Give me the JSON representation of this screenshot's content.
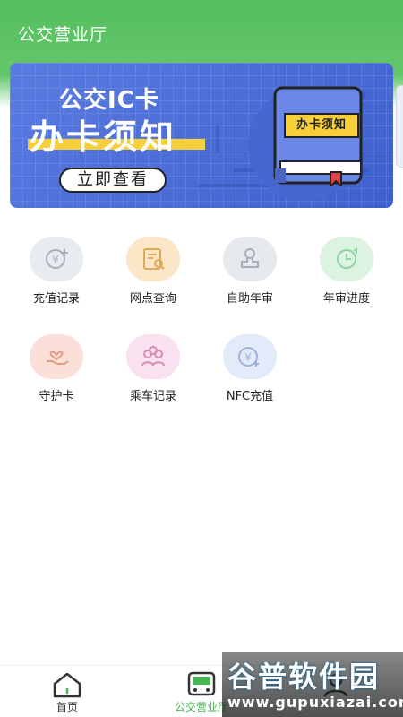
{
  "header": {
    "title": "公交营业厅"
  },
  "banner": {
    "line1": "公交IC卡",
    "line2": "办卡须知",
    "button": "立即查看",
    "book_label": "办卡须知"
  },
  "grid": {
    "items": [
      {
        "label": "充值记录",
        "icon": "yuan-add-icon",
        "color": "#e8ecf1"
      },
      {
        "label": "网点查询",
        "icon": "search-doc-icon",
        "color": "#fbe7c7"
      },
      {
        "label": "自助年审",
        "icon": "stamp-icon",
        "color": "#e6e9ee"
      },
      {
        "label": "年审进度",
        "icon": "clock-icon",
        "color": "#dcf3e2"
      },
      {
        "label": "守护卡",
        "icon": "heart-hand-icon",
        "color": "#fbe0d9"
      },
      {
        "label": "乘车记录",
        "icon": "group-icon",
        "color": "#f9e1ef"
      },
      {
        "label": "NFC充值",
        "icon": "yuan-card-icon",
        "color": "#e3eafa"
      }
    ]
  },
  "tabbar": {
    "tabs": [
      {
        "label": "首页",
        "icon": "home-icon"
      },
      {
        "label": "公交营业厅",
        "icon": "bus-icon",
        "active": true
      },
      {
        "label": "",
        "icon": "profile-icon"
      }
    ]
  },
  "watermark": {
    "big": "谷普软件园",
    "small": "www.gupuxiazai.com"
  },
  "colors": {
    "accent": "#4ab754",
    "banner": "#4f6fd6",
    "highlight": "#f6cf3a"
  }
}
